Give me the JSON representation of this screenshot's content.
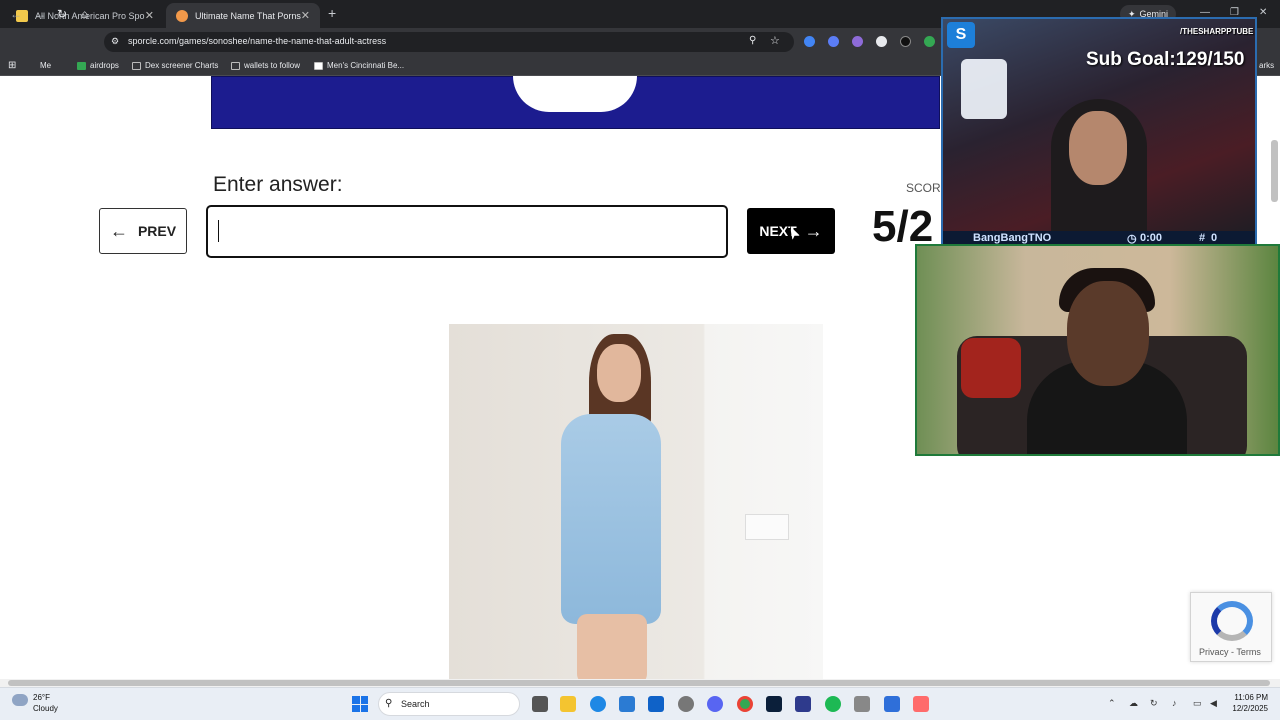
{
  "browser": {
    "tabs": [
      {
        "title": "All North American Pro Sports",
        "active": false
      },
      {
        "title": "Ultimate Name That Pornstar Q",
        "active": true
      }
    ],
    "new_tab": "+",
    "gemini_label": "Gemini",
    "url": "sporcle.com/games/sonoshee/name-the-name-that-adult-actress",
    "bookmarks": [
      "Me",
      "airdrops",
      "Dex screener Charts",
      "wallets to follow",
      "Men's Cincinnati Be..."
    ],
    "bookmarks_overflow": "arks"
  },
  "quiz": {
    "prompt": "Enter answer:",
    "prev_label": "PREV",
    "next_label": "NEXT",
    "answer_value": "",
    "score_label": "SCORE",
    "score_value": "5/2"
  },
  "recaptcha": {
    "links": "Privacy - Terms"
  },
  "overlay": {
    "handle": "/THESHARPPTUBE",
    "sub_goal": "Sub Goal:129/150",
    "stats": {
      "name": "BangBangTNO",
      "time": "0:00",
      "count": "0"
    }
  },
  "taskbar": {
    "weather_temp": "26°F",
    "weather_desc": "Cloudy",
    "search_label": "Search",
    "time": "11:06 PM",
    "date": "12/2/2025"
  }
}
